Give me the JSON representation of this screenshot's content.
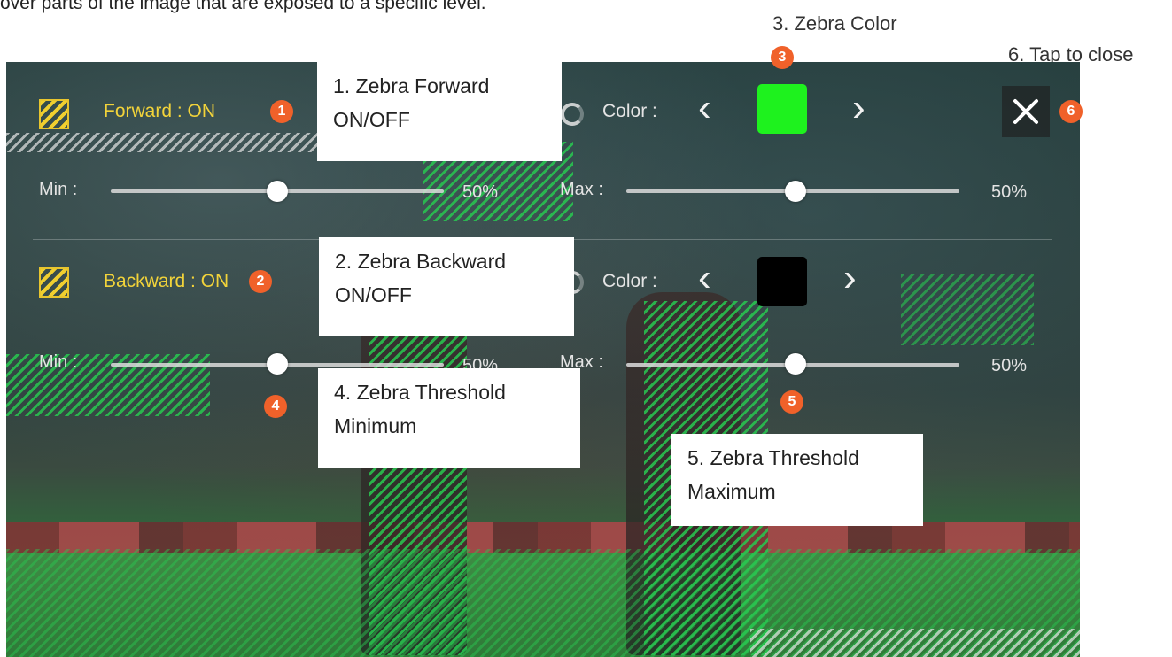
{
  "top_caption": "over parts of the image that are exposed to a specific level.",
  "outer_labels": {
    "zebra_color": "3. Zebra Color",
    "tap_close": "6. Tap to close"
  },
  "forward": {
    "label": "Forward : ON",
    "color_label": "Color :",
    "color": "#1ef21e",
    "min_label": "Min :",
    "min_value": "50%",
    "max_label": "Max :",
    "max_value": "50%"
  },
  "backward": {
    "label": "Backward : ON",
    "color_label": "Color :",
    "color": "#000000",
    "min_label": "Min :",
    "min_value": "50%",
    "max_label": "Max :",
    "max_value": "50%"
  },
  "badges": [
    "1",
    "2",
    "3",
    "4",
    "5",
    "6"
  ],
  "callouts": {
    "c1": [
      "1. Zebra Forward",
      "ON/OFF"
    ],
    "c2": [
      "2. Zebra Backward",
      "ON/OFF"
    ],
    "c4": [
      "4. Zebra Threshold",
      "Minimum"
    ],
    "c5": [
      "5. Zebra Threshold",
      "Maximum"
    ]
  },
  "icons": {
    "prev": "chevron-left-icon",
    "next": "chevron-right-icon",
    "close": "close-icon",
    "zebra": "zebra-stripes-icon",
    "color": "color-ring-icon"
  }
}
